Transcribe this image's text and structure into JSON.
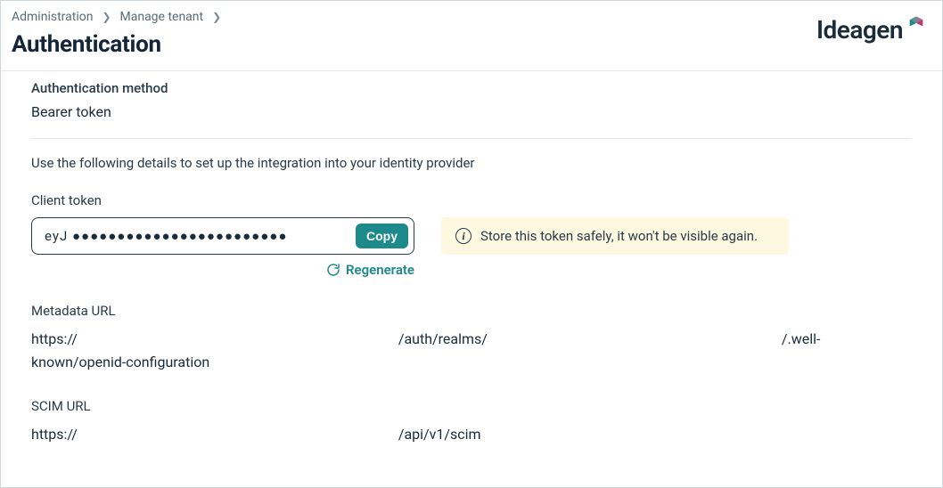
{
  "breadcrumb": {
    "item1": "Administration",
    "item2": "Manage tenant"
  },
  "page_title": "Authentication",
  "brand": {
    "name": "Ideagen"
  },
  "auth_method": {
    "label": "Authentication method",
    "value": "Bearer token"
  },
  "help_text": "Use the following details to set up the integration into your identity provider",
  "client_token": {
    "label": "Client token",
    "masked_value": "eyJ ●●●●●●●●●●●●●●●●●●●●●●●●",
    "copy_label": "Copy",
    "regenerate_label": "Regenerate"
  },
  "alert": {
    "text": "Store this token safely, it won't be visible again."
  },
  "metadata_url": {
    "label": "Metadata URL",
    "part1": "https://",
    "part2": "/auth/realms/",
    "part3": "/.well-known/openid-configuration"
  },
  "scim_url": {
    "label": "SCIM URL",
    "part1": "https://",
    "part2": "/api/v1/scim"
  }
}
